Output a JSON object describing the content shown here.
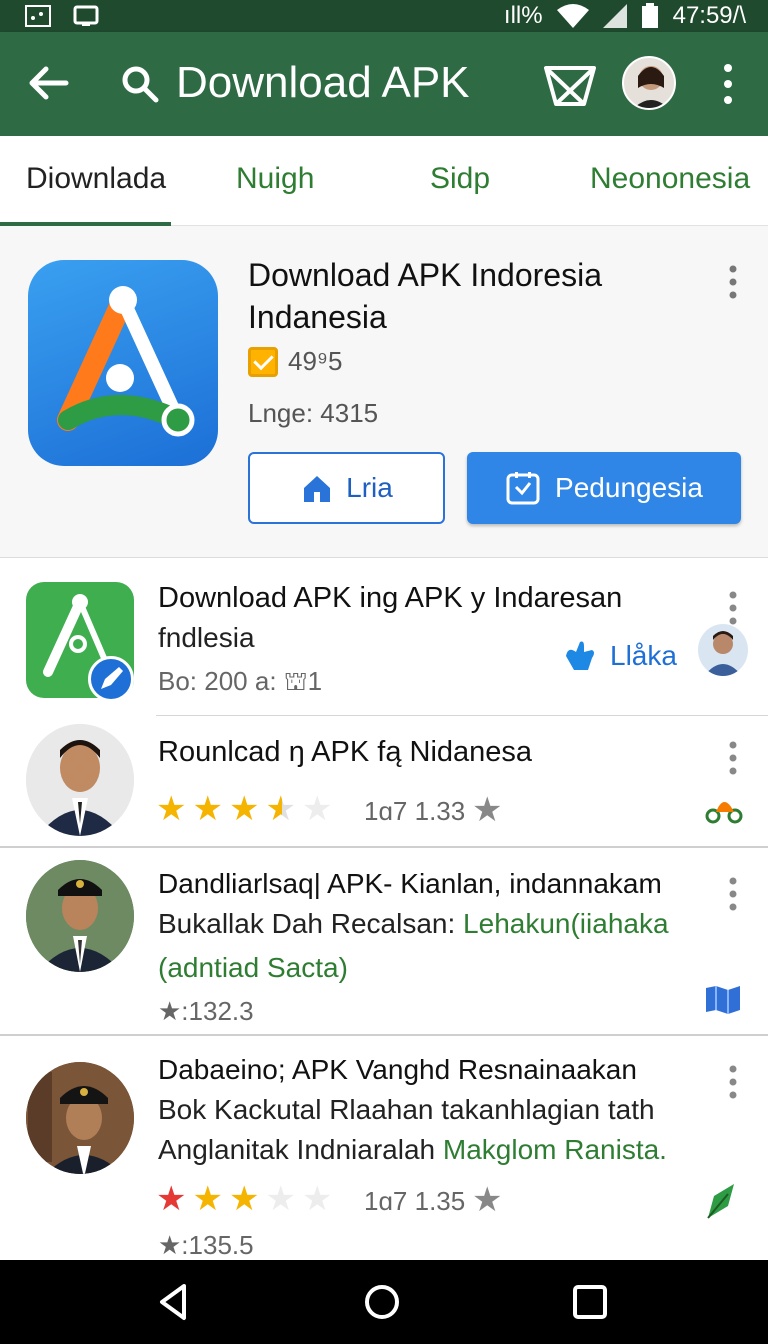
{
  "status_bar": {
    "signal": "ıll%",
    "time": "47:59/\\"
  },
  "app_bar": {
    "title": "Download APK"
  },
  "tabs": [
    {
      "label": "Diownlada",
      "active": true
    },
    {
      "label": "Nuigh",
      "active": false
    },
    {
      "label": "Sidp",
      "active": false
    },
    {
      "label": "Neononesia",
      "active": false
    }
  ],
  "featured": {
    "title": "Download APK Indoresia Indanesia",
    "rating": "49⁹5",
    "subtitle": "Lnge: 4315",
    "secondary_button": "Lria",
    "primary_button": "Pedungesia"
  },
  "items": [
    {
      "title": "Download APK ing APK y Indaresan",
      "line2": "fndlesia",
      "meta": "Bo: 200 a: ⛫1",
      "action_label": "Llåka"
    },
    {
      "title": "Rounlcad ŋ APK fą Nidanesa",
      "rating_text": "1ɑ7 1.33",
      "stars": 3.5
    },
    {
      "title": "Dandliarlsaq| APK- Kianlan, indannakam",
      "line2_prefix": "Bukallak Dah Recalsan: ",
      "line2_green": "Lehakun(iiahaka",
      "line3_green": "(adntiad Sacta)",
      "meta": "★:132.3"
    },
    {
      "title": "Dabaeino; APK Vanghd Resnainaakan",
      "line2": "Bok Kackutal Rlaahan takanhlagian tath",
      "line3_prefix": "Anglanitak Indniaralah ",
      "line3_green": "Makglom Ranista.",
      "rating_text": "1ɑ7 1.35",
      "stars": 3,
      "meta": "★:135.5"
    }
  ],
  "colors": {
    "primary_green": "#2e6b45",
    "accent_blue": "#2f86e6",
    "star_gold": "#f5b400",
    "star_red": "#e53935"
  }
}
